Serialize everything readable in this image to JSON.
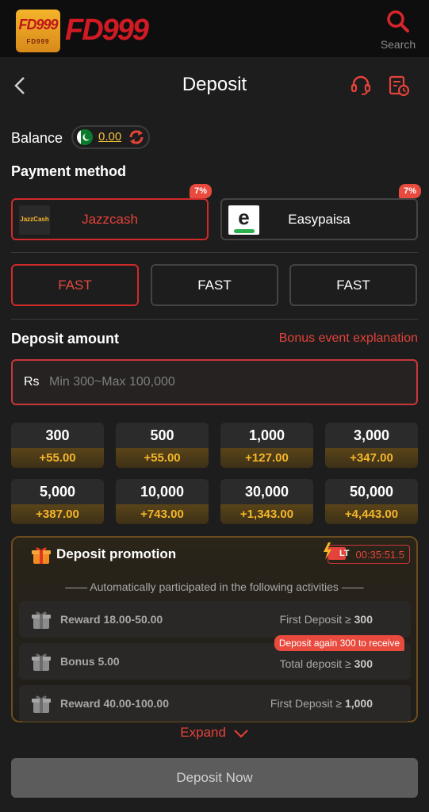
{
  "topbar": {
    "logo_badge": "FD999",
    "logo_badge_sub": "FD999",
    "logo_text": "FD999",
    "search_label": "Search"
  },
  "header": {
    "title": "Deposit"
  },
  "balance": {
    "label": "Balance",
    "value": "0.00"
  },
  "payment": {
    "label": "Payment method",
    "methods": [
      {
        "name": "Jazzcash",
        "badge": "7%",
        "logo_text": "JazzCash",
        "selected": true
      },
      {
        "name": "Easypaisa",
        "badge": "7%",
        "logo_text": "e",
        "selected": false
      }
    ]
  },
  "channels": [
    {
      "label": "FAST",
      "selected": true
    },
    {
      "label": "FAST",
      "selected": false
    },
    {
      "label": "FAST",
      "selected": false
    }
  ],
  "deposit": {
    "label": "Deposit amount",
    "bonus_link": "Bonus event explanation",
    "currency": "Rs",
    "placeholder": "Min 300~Max 100,000"
  },
  "chips": [
    {
      "amount": "300",
      "bonus": "+55.00"
    },
    {
      "amount": "500",
      "bonus": "+55.00"
    },
    {
      "amount": "1,000",
      "bonus": "+127.00"
    },
    {
      "amount": "3,000",
      "bonus": "+347.00"
    },
    {
      "amount": "5,000",
      "bonus": "+387.00"
    },
    {
      "amount": "10,000",
      "bonus": "+743.00"
    },
    {
      "amount": "30,000",
      "bonus": "+1,343.00"
    },
    {
      "amount": "50,000",
      "bonus": "+4,443.00"
    }
  ],
  "promotion": {
    "title": "Deposit promotion",
    "lt_label": "LT",
    "timer": "00:35:51.5",
    "subtitle": "—— Automatically participated in the following activities ——",
    "activities": [
      {
        "name": "Reward 18.00-50.00",
        "cond_text": "First Deposit ≥ ",
        "cond_value": "300",
        "tag": ""
      },
      {
        "name": "Bonus 5.00",
        "cond_text": "Total deposit ≥ ",
        "cond_value": "300",
        "tag": "Deposit again 300 to receive"
      },
      {
        "name": "Reward 40.00-100.00",
        "cond_text": "First Deposit ≥ ",
        "cond_value": "1,000",
        "tag": ""
      }
    ]
  },
  "expand_label": "Expand",
  "submit_label": "Deposit Now",
  "colors": {
    "accent": "#e3433a",
    "gold": "#f5b62a",
    "background": "#1d1d1d"
  }
}
